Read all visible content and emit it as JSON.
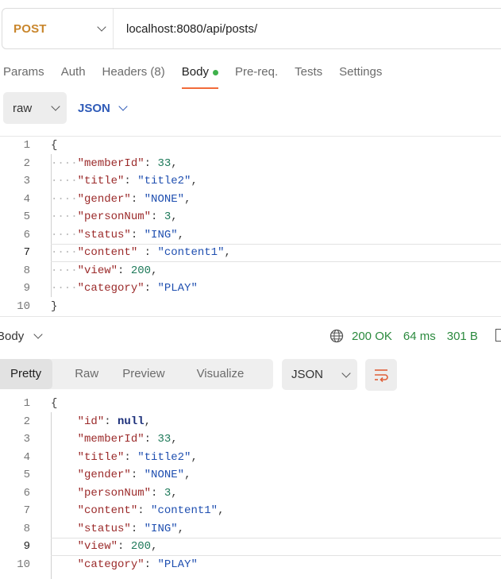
{
  "request": {
    "method": "POST",
    "url": "localhost:8080/api/posts/"
  },
  "request_tabs": [
    {
      "label": "Params"
    },
    {
      "label": "Auth"
    },
    {
      "label": "Headers (8)"
    },
    {
      "label": "Body",
      "active": true,
      "indicator": "green-dot"
    },
    {
      "label": "Pre-req."
    },
    {
      "label": "Tests"
    },
    {
      "label": "Settings"
    }
  ],
  "body_options": {
    "mode": "raw",
    "language": "JSON"
  },
  "request_body": {
    "line_numbers": [
      "1",
      "2",
      "3",
      "4",
      "5",
      "6",
      "7",
      "8",
      "9",
      "10"
    ],
    "lines": [
      {
        "key": "",
        "value": "",
        "text": "{"
      },
      {
        "key": "\"memberId\"",
        "sep": ": ",
        "value": "33",
        "trail": ","
      },
      {
        "key": "\"title\"",
        "sep": ": ",
        "value": "\"title2\"",
        "trail": ","
      },
      {
        "key": "\"gender\"",
        "sep": ": ",
        "value": "\"NONE\"",
        "trail": ","
      },
      {
        "key": "\"personNum\"",
        "sep": ": ",
        "value": "3",
        "trail": ","
      },
      {
        "key": "\"status\"",
        "sep": ": ",
        "value": "\"ING\"",
        "trail": ","
      },
      {
        "key": "\"content\"",
        "sep": " : ",
        "value": "\"content1\"",
        "trail": ","
      },
      {
        "key": "\"view\"",
        "sep": ": ",
        "value": "200",
        "trail": ","
      },
      {
        "key": "\"category\"",
        "sep": ": ",
        "value": "\"PLAY\"",
        "trail": ""
      },
      {
        "text": "}"
      }
    ]
  },
  "response": {
    "section_label": "Body",
    "status": "200 OK",
    "time": "64 ms",
    "size": "301 B",
    "view_tabs": [
      {
        "label": "Pretty",
        "active": true
      },
      {
        "label": "Raw"
      },
      {
        "label": "Preview"
      },
      {
        "label": "Visualize"
      }
    ],
    "format": "JSON"
  },
  "response_body": {
    "line_numbers": [
      "1",
      "2",
      "3",
      "4",
      "5",
      "6",
      "7",
      "8",
      "9",
      "10"
    ],
    "lines": [
      {
        "text": "{"
      },
      {
        "key": "\"id\"",
        "sep": ": ",
        "value": "null",
        "trail": ","
      },
      {
        "key": "\"memberId\"",
        "sep": ": ",
        "value": "33",
        "trail": ","
      },
      {
        "key": "\"title\"",
        "sep": ": ",
        "value": "\"title2\"",
        "trail": ","
      },
      {
        "key": "\"gender\"",
        "sep": ": ",
        "value": "\"NONE\"",
        "trail": ","
      },
      {
        "key": "\"personNum\"",
        "sep": ": ",
        "value": "3",
        "trail": ","
      },
      {
        "key": "\"content\"",
        "sep": ": ",
        "value": "\"content1\"",
        "trail": ","
      },
      {
        "key": "\"status\"",
        "sep": ": ",
        "value": "\"ING\"",
        "trail": ","
      },
      {
        "key": "\"view\"",
        "sep": ": ",
        "value": "200",
        "trail": ","
      },
      {
        "key": "\"category\"",
        "sep": ": ",
        "value": "\"PLAY\"",
        "trail": ""
      }
    ]
  },
  "icons": {
    "method_dropdown": "chevron-down-icon",
    "status_globe": "globe-icon",
    "wrap_toggle": "wrap-lines-icon"
  },
  "colors": {
    "method": "#c9862c",
    "active_tab_underline": "#f26b3a",
    "status_ok": "#2b8a3e",
    "json_link": "#2f5bb8"
  }
}
